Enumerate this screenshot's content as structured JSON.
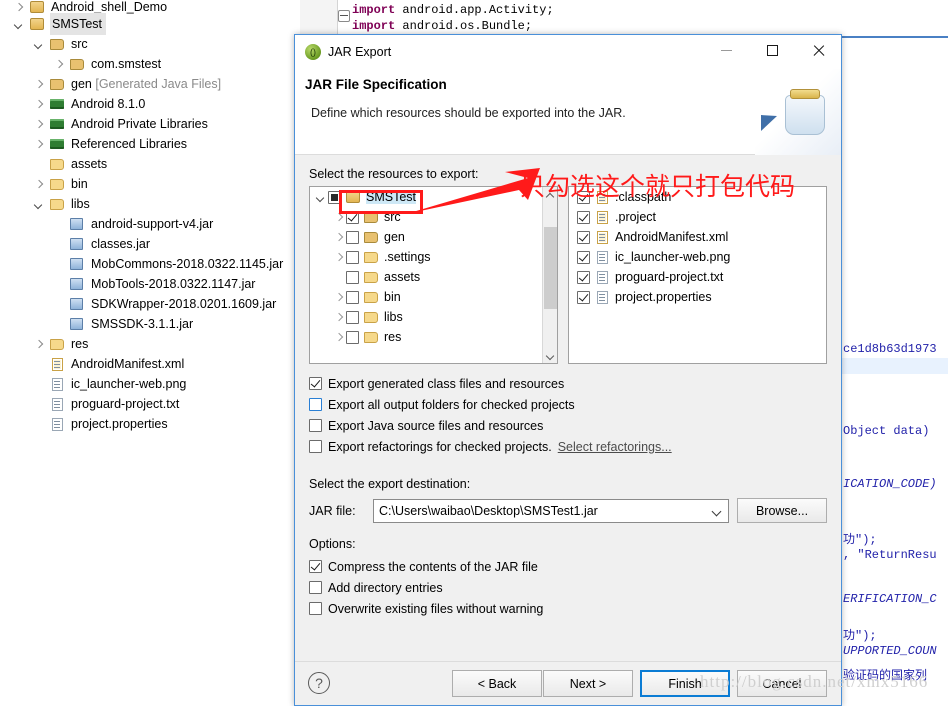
{
  "explorer": {
    "items": [
      {
        "label": "Android_shell_Demo",
        "icon": "project-icon",
        "twisty": "collapsed",
        "indent": 0,
        "selected": false,
        "partial": true
      },
      {
        "label": "SMSTest",
        "icon": "project-icon",
        "twisty": "expanded",
        "indent": 0,
        "selected": true
      },
      {
        "label": "src",
        "icon": "source-folder-icon",
        "twisty": "expanded",
        "indent": 1,
        "selected": false
      },
      {
        "label": "com.smstest",
        "icon": "package-icon",
        "twisty": "collapsed",
        "indent": 2,
        "selected": false
      },
      {
        "label": "gen ",
        "suffix": "[Generated Java Files]",
        "icon": "source-folder-icon",
        "twisty": "collapsed",
        "indent": 1,
        "selected": false
      },
      {
        "label": "Android 8.1.0",
        "icon": "library-icon",
        "twisty": "collapsed",
        "indent": 1,
        "selected": false
      },
      {
        "label": "Android Private Libraries",
        "icon": "library-icon",
        "twisty": "collapsed",
        "indent": 1,
        "selected": false
      },
      {
        "label": "Referenced Libraries",
        "icon": "library-icon",
        "twisty": "collapsed",
        "indent": 1,
        "selected": false
      },
      {
        "label": "assets",
        "icon": "folder-icon",
        "twisty": "none",
        "indent": 1,
        "selected": false
      },
      {
        "label": "bin",
        "icon": "folder-icon",
        "twisty": "collapsed",
        "indent": 1,
        "selected": false
      },
      {
        "label": "libs",
        "icon": "folder-icon",
        "twisty": "expanded",
        "indent": 1,
        "selected": false
      },
      {
        "label": "android-support-v4.jar",
        "icon": "jar-icon",
        "twisty": "none",
        "indent": 2,
        "selected": false
      },
      {
        "label": "classes.jar",
        "icon": "jar-icon",
        "twisty": "none",
        "indent": 2,
        "selected": false
      },
      {
        "label": "MobCommons-2018.0322.1145.jar",
        "icon": "jar-icon",
        "twisty": "none",
        "indent": 2,
        "selected": false
      },
      {
        "label": "MobTools-2018.0322.1147.jar",
        "icon": "jar-icon",
        "twisty": "none",
        "indent": 2,
        "selected": false
      },
      {
        "label": "SDKWrapper-2018.0201.1609.jar",
        "icon": "jar-icon",
        "twisty": "none",
        "indent": 2,
        "selected": false
      },
      {
        "label": "SMSSDK-3.1.1.jar",
        "icon": "jar-icon",
        "twisty": "none",
        "indent": 2,
        "selected": false
      },
      {
        "label": "res",
        "icon": "folder-icon",
        "twisty": "collapsed",
        "indent": 1,
        "selected": false
      },
      {
        "label": "AndroidManifest.xml",
        "icon": "xml-icon",
        "twisty": "none",
        "indent": 1,
        "selected": false
      },
      {
        "label": "ic_launcher-web.png",
        "icon": "file-icon",
        "twisty": "none",
        "indent": 1,
        "selected": false
      },
      {
        "label": "proguard-project.txt",
        "icon": "file-icon",
        "twisty": "none",
        "indent": 1,
        "selected": false
      },
      {
        "label": "project.properties",
        "icon": "file-icon",
        "twisty": "none",
        "indent": 1,
        "selected": false
      }
    ]
  },
  "editor": {
    "top_lines": [
      "import android.app.Activity;",
      "import android.os.Bundle;"
    ],
    "right_fragments": [
      "ce1d8b63d1973",
      "Object data)",
      "ICATION_CODE)",
      "功\");",
      ", \"ReturnResu",
      "ERIFICATION_C",
      "功\");",
      "UPPORTED_COUN",
      "验证码的国家列"
    ]
  },
  "dialog": {
    "title": "JAR Export",
    "heading": "JAR File Specification",
    "subtitle": "Define which resources should be exported into the JAR.",
    "resources_label": "Select the resources to export:",
    "left_tree": [
      {
        "label": "SMSTest",
        "checkbox": "gray",
        "icon": "project-icon",
        "twisty": "expanded",
        "indent": 0,
        "selected": true
      },
      {
        "label": "src",
        "checkbox": "checked",
        "icon": "source-folder-icon",
        "twisty": "collapsed",
        "indent": 1,
        "selected": false
      },
      {
        "label": "gen",
        "checkbox": "unchecked",
        "icon": "source-folder-icon",
        "twisty": "collapsed",
        "indent": 1,
        "selected": false
      },
      {
        "label": ".settings",
        "checkbox": "unchecked",
        "icon": "folder-icon",
        "twisty": "collapsed",
        "indent": 1,
        "selected": false
      },
      {
        "label": "assets",
        "checkbox": "unchecked",
        "icon": "folder-icon",
        "twisty": "none",
        "indent": 1,
        "selected": false
      },
      {
        "label": "bin",
        "checkbox": "unchecked",
        "icon": "folder-icon",
        "twisty": "collapsed",
        "indent": 1,
        "selected": false
      },
      {
        "label": "libs",
        "checkbox": "unchecked",
        "icon": "folder-icon",
        "twisty": "collapsed",
        "indent": 1,
        "selected": false
      },
      {
        "label": "res",
        "checkbox": "unchecked",
        "icon": "folder-icon",
        "twisty": "collapsed",
        "indent": 1,
        "selected": false
      }
    ],
    "right_list": [
      {
        "label": ".classpath",
        "checkbox": "checked",
        "icon": "xml-icon"
      },
      {
        "label": ".project",
        "checkbox": "checked",
        "icon": "xml-icon"
      },
      {
        "label": "AndroidManifest.xml",
        "checkbox": "checked",
        "icon": "manifest-icon"
      },
      {
        "label": "ic_launcher-web.png",
        "checkbox": "checked",
        "icon": "file-icon"
      },
      {
        "label": "proguard-project.txt",
        "checkbox": "checked",
        "icon": "file-icon"
      },
      {
        "label": "project.properties",
        "checkbox": "checked",
        "icon": "file-icon"
      }
    ],
    "export_options": [
      {
        "label": "Export generated class files and resources",
        "checked": true,
        "focus": false
      },
      {
        "label": "Export all output folders for checked projects",
        "checked": false,
        "focus": true
      },
      {
        "label": "Export Java source files and resources",
        "checked": false,
        "focus": false
      },
      {
        "label": "Export refactorings for checked projects.",
        "checked": false,
        "focus": false,
        "link": "Select refactorings..."
      }
    ],
    "destination_label": "Select the export destination:",
    "jarfile_label": "JAR file:",
    "jarfile_value": "C:\\Users\\waibao\\Desktop\\SMSTest1.jar",
    "browse_label": "Browse...",
    "options_label": "Options:",
    "options": [
      {
        "label": "Compress the contents of the JAR file",
        "checked": true
      },
      {
        "label": "Add directory entries",
        "checked": false
      },
      {
        "label": "Overwrite existing files without warning",
        "checked": false
      }
    ],
    "buttons": {
      "back": "< Back",
      "next": "Next >",
      "finish": "Finish",
      "cancel": "Cancel",
      "help": "?"
    }
  },
  "annotation": {
    "text": "只勾选这个就只打包代码",
    "color": "#ff1a1a"
  },
  "watermark": "http://blog.csdn.net/xmx5166"
}
